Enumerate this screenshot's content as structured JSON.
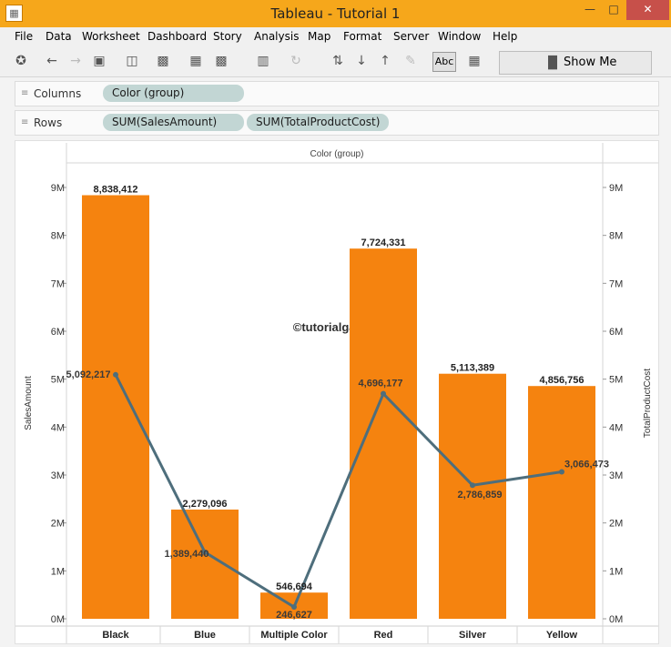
{
  "window": {
    "title": "Tableau - Tutorial 1"
  },
  "menu": [
    "File",
    "Data",
    "Worksheet",
    "Dashboard",
    "Story",
    "Analysis",
    "Map",
    "Format",
    "Server",
    "Window",
    "Help"
  ],
  "toolbar": {
    "abc_label": "Abc",
    "show_me_label": "Show Me"
  },
  "shelves": {
    "columns": {
      "label": "Columns",
      "pills": [
        "Color (group)"
      ]
    },
    "rows": {
      "label": "Rows",
      "pills": [
        "SUM(SalesAmount)",
        "SUM(TotalProductCost)"
      ]
    }
  },
  "watermark": "©tutorialgateway.org",
  "chart_data": {
    "type": "bar",
    "title": "Color (group)",
    "categories": [
      "Black",
      "Blue",
      "Multiple Color",
      "Red",
      "Silver",
      "Yellow"
    ],
    "series": [
      {
        "name": "SalesAmount",
        "type": "bar",
        "values": [
          8838412,
          2279096,
          546694,
          7724331,
          5113389,
          4856756
        ],
        "labels": [
          "8,838,412",
          "2,279,096",
          "546,694",
          "7,724,331",
          "5,113,389",
          "4,856,756"
        ],
        "color": "#f5830f"
      },
      {
        "name": "TotalProductCost",
        "type": "line",
        "values": [
          5092217,
          1389440,
          246627,
          4696177,
          2786859,
          3066473
        ],
        "labels": [
          "5,092,217",
          "1,389,440",
          "246,627",
          "4,696,177",
          "2,786,859",
          "3,066,473"
        ],
        "color": "#4e6e7c"
      }
    ],
    "ylabel": "SalesAmount",
    "y2label": "TotalProductCost",
    "ylim": [
      0,
      9000000
    ],
    "yticks": [
      "0M",
      "1M",
      "2M",
      "3M",
      "4M",
      "5M",
      "6M",
      "7M",
      "8M",
      "9M"
    ],
    "grid": false,
    "legend": "none"
  }
}
